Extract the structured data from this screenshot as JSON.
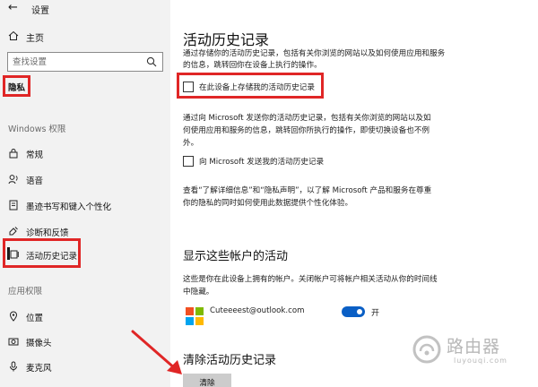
{
  "window": {
    "title": "设置"
  },
  "sidebar": {
    "home_label": "主页",
    "search_placeholder": "查找设置",
    "privacy_header": "隐私",
    "section_windows": "Windows 权限",
    "section_app": "应用权限",
    "items": [
      {
        "label": "常规",
        "icon": "lock-icon"
      },
      {
        "label": "语音",
        "icon": "speech-icon"
      },
      {
        "label": "墨迹书写和键入个性化",
        "icon": "ink-icon"
      },
      {
        "label": "诊断和反馈",
        "icon": "feedback-icon"
      },
      {
        "label": "活动历史记录",
        "icon": "activity-history-icon",
        "selected": true
      },
      {
        "label": "位置",
        "icon": "location-icon"
      },
      {
        "label": "摄像头",
        "icon": "camera-icon"
      },
      {
        "label": "麦克风",
        "icon": "microphone-icon"
      }
    ]
  },
  "main": {
    "title": "活动历史记录",
    "intro_text": "通过存储你的活动历史记录，包括有关你浏览的网站以及如何使用应用和服务的信息，跳转回你在设备上执行的操作。",
    "checkbox_store": {
      "label": "在此设备上存储我的活动历史记录",
      "checked": false
    },
    "send_text": "通过向 Microsoft 发送你的活动历史记录，包括有关你浏览的网站以及如何使用应用和服务的信息，跳转回你所执行的操作，即使切换设备也不例外。",
    "checkbox_send": {
      "label": "向 Microsoft 发送我的活动历史记录",
      "checked": false
    },
    "privacy_text": "查看“了解详细信息”和“隐私声明”，以了解 Microsoft 产品和服务在尊重你的隐私的同时如何使用此数据提供个性化体验。",
    "accounts_heading": "显示这些帐户的活动",
    "accounts_text": "这些是你在此设备上拥有的帐户。关闭帐户可将帐户相关活动从你的时间线中隐藏。",
    "account": {
      "email": "Cuteeeest@outlook.com",
      "toggle_state": "开",
      "enabled": true
    },
    "clear_heading": "清除活动历史记录",
    "clear_button": "清除"
  },
  "colors": {
    "accent": "#0a5fc5",
    "highlight_red": "#e02626",
    "sidebar_bg": "#f2f2f2"
  },
  "watermark": {
    "text": "路由器",
    "subtext": "luyouqi.com"
  }
}
